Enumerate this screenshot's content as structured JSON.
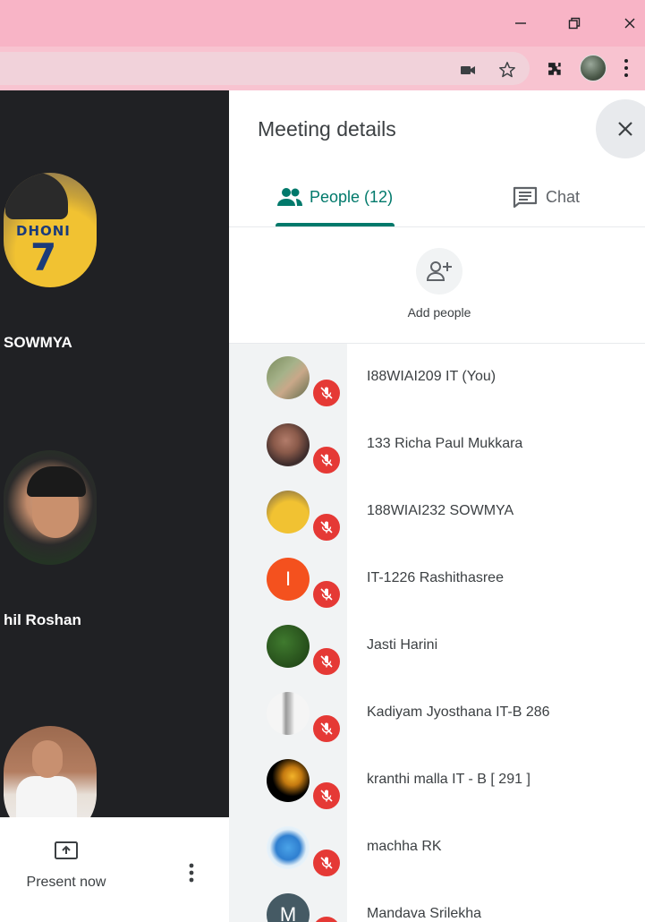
{
  "meeting_panel": {
    "title": "Meeting details",
    "tabs": [
      {
        "label": "People (12)",
        "icon": "people-icon",
        "active": true
      },
      {
        "label": "Chat",
        "icon": "chat-icon",
        "active": false
      }
    ],
    "add_people_label": "Add people",
    "participants": [
      {
        "name": "I88WIAI209 IT (You)",
        "avatar": "photo",
        "muted": true
      },
      {
        "name": "133 Richa Paul Mukkara",
        "avatar": "photo",
        "muted": true
      },
      {
        "name": "188WIAI232 SOWMYA",
        "avatar": "photo",
        "muted": true
      },
      {
        "name": "IT-1226 Rashithasree",
        "avatar": "initial",
        "initial": "I",
        "color": "#f4511e",
        "muted": true
      },
      {
        "name": "Jasti Harini",
        "avatar": "photo",
        "muted": true
      },
      {
        "name": "Kadiyam Jyosthana IT-B 286",
        "avatar": "photo",
        "muted": true
      },
      {
        "name": "kranthi malla IT - B [ 291 ]",
        "avatar": "photo",
        "muted": true
      },
      {
        "name": "machha RK",
        "avatar": "photo",
        "muted": true
      },
      {
        "name": "Mandava Srilekha",
        "avatar": "initial",
        "initial": "M",
        "color": "#455a64",
        "muted": true
      }
    ]
  },
  "stage": {
    "tiles": [
      {
        "name": "SOWMYA",
        "jersey": "DHONI",
        "number": "7"
      },
      {
        "name": "hil Roshan"
      },
      {
        "name": ""
      }
    ]
  },
  "controls": {
    "present_label": "Present now"
  },
  "colors": {
    "accent": "#00796b",
    "titlebar": "#f8b4c6",
    "stage_bg": "#202124",
    "mute_red": "#e53935"
  }
}
